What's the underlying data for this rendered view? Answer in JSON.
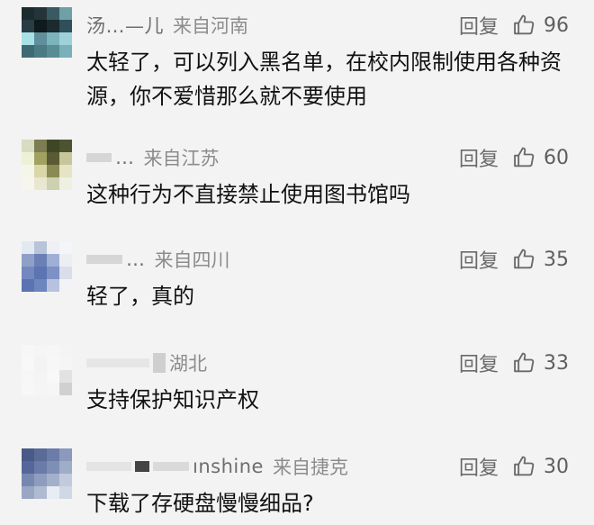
{
  "comments": [
    {
      "nickname": "汤…—儿",
      "location": "来自河南",
      "reply": "回复",
      "likes": "96",
      "text": "太轻了，可以列入黑名单，在校内限制使用各种资源，你不爱惜那么就不要使用",
      "avatar_icon": "blurred-avatar-icon"
    },
    {
      "nickname": "…",
      "location": "来自江苏",
      "reply": "回复",
      "likes": "60",
      "text": "这种行为不直接禁止使用图书馆吗",
      "avatar_icon": "blurred-avatar-icon"
    },
    {
      "nickname": "…",
      "location": "来自四川",
      "reply": "回复",
      "likes": "35",
      "text": "轻了，真的",
      "avatar_icon": "blurred-avatar-icon"
    },
    {
      "nickname": "",
      "location": "湖北",
      "reply": "回复",
      "likes": "33",
      "text": "支持保护知识产权",
      "avatar_icon": "blurred-avatar-icon"
    },
    {
      "nickname": "ınshine",
      "location": "来自捷克",
      "reply": "回复",
      "likes": "30",
      "text": "下载了存硬盘慢慢细品?",
      "avatar_icon": "blurred-avatar-icon"
    }
  ],
  "colors": {
    "background": "#f3f3f3",
    "text": "#111111",
    "meta": "#8c8c8c",
    "action": "#6a6a6a"
  },
  "icons": {
    "like": "thumbs-up-icon"
  }
}
